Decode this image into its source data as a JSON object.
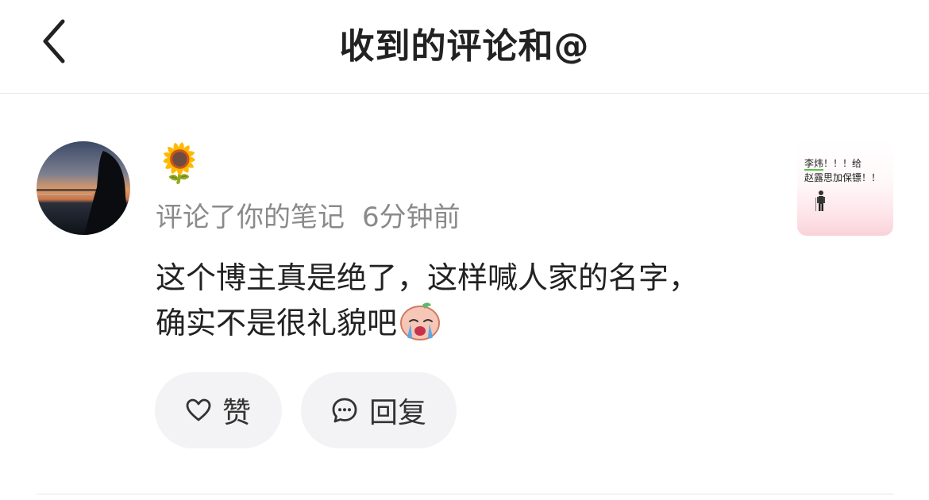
{
  "header": {
    "title": "收到的评论和@",
    "back_icon": "chevron-left-icon"
  },
  "notification": {
    "user": {
      "name": "🌻",
      "avatar_description": "sunset-silhouette-avatar"
    },
    "action_text": "评论了你的笔记",
    "time": "6分钟前",
    "comment_text": "这个博主真是绝了，这样喊人家的名字，确实不是很礼貌吧",
    "comment_emoji_icon": "crying-face-sticker-icon",
    "actions": {
      "like_label": "赞",
      "reply_label": "回复"
    },
    "note_thumbnail": {
      "line1_highlight": "李炜",
      "line1_rest": "！！！给",
      "line2": "赵露思加保镖！！"
    }
  },
  "colors": {
    "meta_text": "#8a8a8a",
    "button_bg": "#f3f3f5",
    "thumb_pink": "#f9d2d9"
  }
}
